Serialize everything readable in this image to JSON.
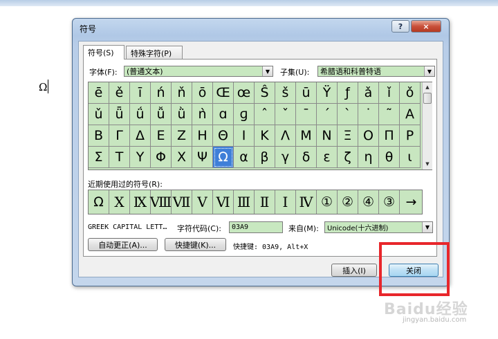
{
  "document": {
    "inserted_text": "Ω"
  },
  "dialog": {
    "title": "符号",
    "help_button": "?",
    "close_button": "×",
    "tabs": [
      {
        "label": "符号(S)",
        "active": true
      },
      {
        "label": "特殊字符(P)",
        "active": false
      }
    ],
    "font_label": "字体(F):",
    "font_value": "(普通文本)",
    "subset_label": "子集(U):",
    "subset_value": "希腊语和科普特语",
    "symbols": [
      [
        "ē",
        "ě",
        "ī",
        "ń",
        "ň",
        "ō",
        "Œ",
        "œ",
        "Ŝ",
        "š",
        "ū",
        "Ÿ",
        "ƒ",
        "ǎ",
        "ǐ",
        "ǒ"
      ],
      [
        "ǔ",
        "ǖ",
        "ǘ",
        "ǚ",
        "ǜ",
        "ǹ",
        "ɑ",
        "ɡ",
        "ˆ",
        "ˇ",
        "ˉ",
        "ˊ",
        "ˋ",
        "˙",
        "˜",
        "Α"
      ],
      [
        "Β",
        "Γ",
        "Δ",
        "Ε",
        "Ζ",
        "Η",
        "Θ",
        "Ι",
        "Κ",
        "Λ",
        "Μ",
        "Ν",
        "Ξ",
        "Ο",
        "Π",
        "Ρ"
      ],
      [
        "Σ",
        "Τ",
        "Υ",
        "Φ",
        "Χ",
        "Ψ",
        "Ω",
        "α",
        "β",
        "γ",
        "δ",
        "ε",
        "ζ",
        "η",
        "θ",
        "ι"
      ]
    ],
    "selected_symbol": "Ω",
    "recent_label": "近期使用过的符号(R):",
    "recent_symbols": [
      "Ω",
      "Ⅹ",
      "Ⅸ",
      "Ⅷ",
      "Ⅶ",
      "Ⅴ",
      "Ⅵ",
      "Ⅲ",
      "Ⅱ",
      "Ⅰ",
      "Ⅳ",
      "①",
      "②",
      "④",
      "③",
      "→"
    ],
    "char_name": "GREEK CAPITAL LETT…",
    "char_code_label": "字符代码(C):",
    "char_code_value": "03A9",
    "from_label": "来自(M):",
    "from_value": "Unicode(十六进制)",
    "autocorrect_button": "自动更正(A)...",
    "shortcut_key_button": "快捷键(K)...",
    "shortcut_text": "快捷键: 03A9, Alt+X",
    "insert_button": "插入(I)",
    "close_text_button": "关闭"
  },
  "watermark": {
    "logo": "Baidu经验",
    "sub": "jingyan.baidu.com"
  },
  "colors": {
    "accent_highlight": "#e8262b",
    "grid_bg": "#c8e6c0",
    "selection": "#3f7fd8"
  }
}
